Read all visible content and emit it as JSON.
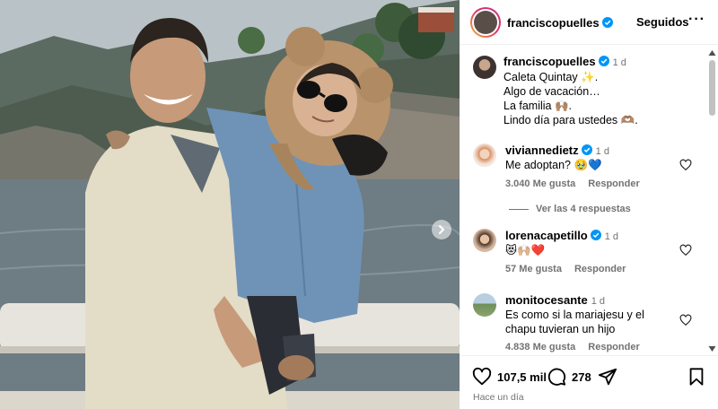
{
  "post": {
    "author": "franciscopuelles",
    "follow_label": "Seguidos",
    "more_label": "···",
    "caption": {
      "author": "franciscopuelles",
      "time": "1 d",
      "lines": [
        "Caleta Quintay ✨.",
        "Algo de vacación…",
        "La familia 🙌🏽.",
        "Lindo día para ustedes 🫶🏽."
      ]
    }
  },
  "comments": [
    {
      "author": "viviannedietz",
      "verified": true,
      "time": "1 d",
      "text": "Me adoptan? 🥹💙",
      "likes": "3.040 Me gusta",
      "reply": "Responder",
      "view_replies": "Ver las 4 respuestas"
    },
    {
      "author": "lorenacapetillo",
      "verified": true,
      "time": "1 d",
      "text": "😻🙌🏼❤️",
      "likes": "57 Me gusta",
      "reply": "Responder"
    },
    {
      "author": "monitocesante",
      "verified": false,
      "time": "1 d",
      "text": "Es como si la mariajesu y el chapu tuvieran un hijo",
      "likes": "4.838 Me gusta",
      "reply": "Responder"
    }
  ],
  "actions": {
    "likes": "107,5 mil",
    "comments": "278",
    "posted": "Hace un día"
  },
  "icons": [
    "verified-icon",
    "heart-icon",
    "comment-icon",
    "share-icon",
    "save-icon",
    "chevron-right-icon",
    "more-icon"
  ],
  "colors": {
    "verified": "#0095f6",
    "muted": "#737373"
  }
}
